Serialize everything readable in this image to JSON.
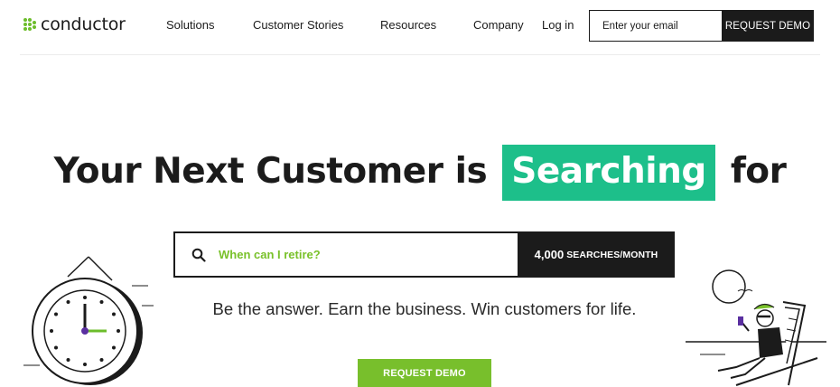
{
  "brand": {
    "name": "conductor",
    "accent": "#6cbd2b"
  },
  "nav": {
    "items": [
      {
        "label": "Solutions"
      },
      {
        "label": "Customer Stories"
      },
      {
        "label": "Resources"
      },
      {
        "label": "Company"
      },
      {
        "label": "Log in"
      }
    ]
  },
  "header_form": {
    "email_placeholder": "Enter your email",
    "cta_label": "REQUEST DEMO"
  },
  "hero": {
    "headline_pre": "Your Next Customer is",
    "headline_highlight": "Searching",
    "headline_post": "for",
    "highlight_color": "#1dbf8a",
    "search_query": "When can I retire?",
    "search_volume_number": "4,000",
    "search_volume_unit": "SEARCHES/MONTH",
    "subtitle": "Be the answer. Earn the business. Win customers for life.",
    "cta_label": "REQUEST DEMO",
    "cta_color": "#78bf2c"
  },
  "icons": {
    "logo": "dots-grid-icon",
    "search": "magnifier-icon",
    "clock": "wall-clock-illustration",
    "beach": "beach-chair-illustration"
  }
}
